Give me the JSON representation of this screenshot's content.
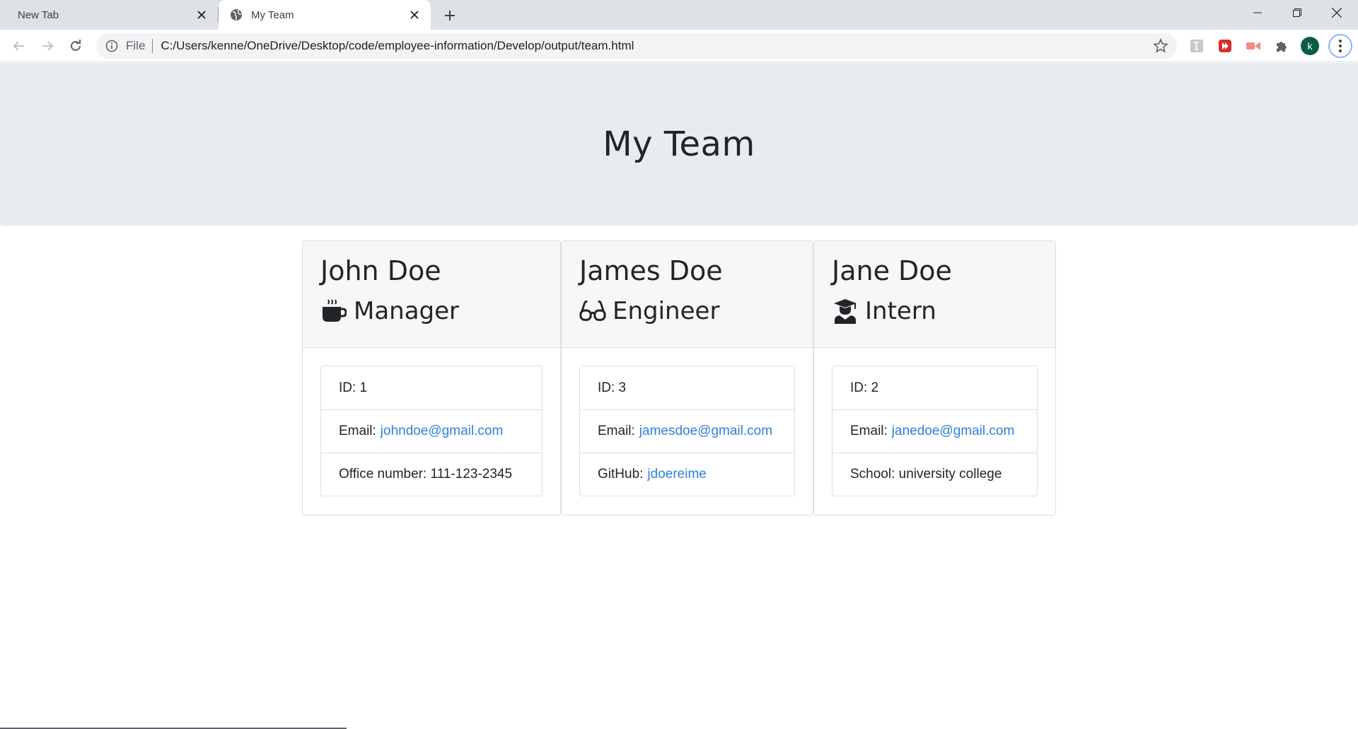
{
  "browser": {
    "tabs": [
      {
        "title": "New Tab",
        "active": false
      },
      {
        "title": "My Team",
        "active": true
      }
    ],
    "address": {
      "scheme_label": "File",
      "url": "C:/Users/kenne/OneDrive/Desktop/code/employee-information/Develop/output/team.html"
    },
    "profile_initial": "k"
  },
  "page": {
    "heading": "My Team",
    "employees": [
      {
        "name": "John Doe",
        "role": "Manager",
        "icon": "mug-icon",
        "id_label": "ID: 1",
        "email_label": "Email:",
        "email": "johndoe@gmail.com",
        "extra_label": "Office number: 111-123-2345",
        "extra_link": ""
      },
      {
        "name": "James Doe",
        "role": "Engineer",
        "icon": "glasses-icon",
        "id_label": "ID: 3",
        "email_label": "Email:",
        "email": "jamesdoe@gmail.com",
        "extra_label": "GitHub:",
        "extra_link": "jdoereime"
      },
      {
        "name": "Jane Doe",
        "role": "Intern",
        "icon": "graduate-icon",
        "id_label": "ID: 2",
        "email_label": "Email:",
        "email": "janedoe@gmail.com",
        "extra_label": "School: university college",
        "extra_link": ""
      }
    ]
  },
  "colors": {
    "jumbotron_bg": "#e9ecef",
    "card_header_bg": "#f7f7f7",
    "link": "#2f7fe0",
    "text": "#212529"
  }
}
